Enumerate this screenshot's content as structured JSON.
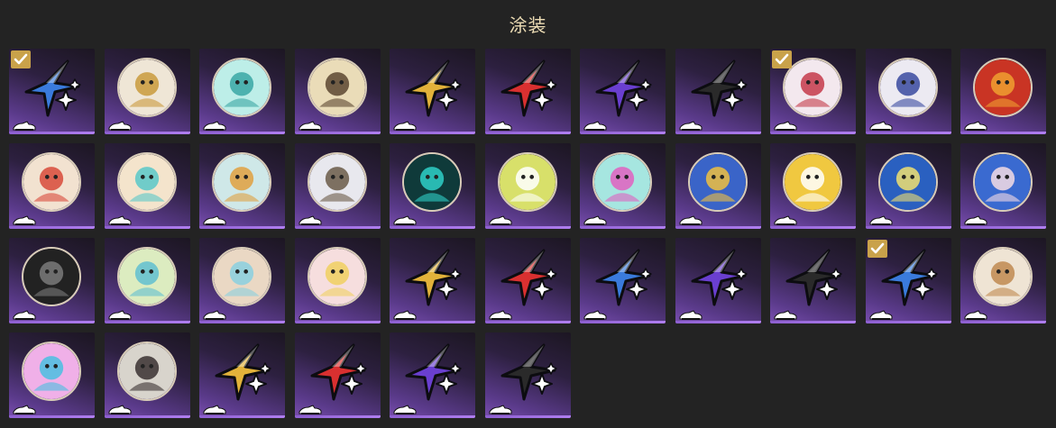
{
  "page_title": "涂装",
  "colors": {
    "background": "#232323",
    "title": "#ecdcb4",
    "check": "#c9a24a",
    "tile_gradient_end": "#7a4fb0"
  },
  "items": [
    {
      "kind": "star",
      "color": "#3a7bdc",
      "equipped": true
    },
    {
      "kind": "badge",
      "icon": "character-badge-icon",
      "bg": "#efe6d6",
      "accent": "#c99a3c",
      "equipped": false
    },
    {
      "kind": "badge",
      "icon": "swirl-badge-icon",
      "bg": "#bdeee8",
      "accent": "#3aa7a4",
      "equipped": false
    },
    {
      "kind": "badge",
      "icon": "character-badge-icon",
      "bg": "#eadcb8",
      "accent": "#5c4630",
      "equipped": false
    },
    {
      "kind": "star",
      "color": "#e2b23a",
      "equipped": false
    },
    {
      "kind": "star",
      "color": "#d93030",
      "equipped": false
    },
    {
      "kind": "star",
      "color": "#6a3fd0",
      "equipped": false
    },
    {
      "kind": "star",
      "color": "#2a2a2a",
      "equipped": false
    },
    {
      "kind": "badge",
      "icon": "shark-badge-icon",
      "bg": "#f3e8ee",
      "accent": "#c43a4a",
      "equipped": true
    },
    {
      "kind": "badge",
      "icon": "helmet-badge-icon",
      "bg": "#eceaf2",
      "accent": "#3a4aa0",
      "equipped": false
    },
    {
      "kind": "badge",
      "icon": "angry-bird-badge-icon",
      "bg": "#c93424",
      "accent": "#f0a030",
      "equipped": false
    },
    {
      "kind": "badge",
      "icon": "group-badge-icon",
      "bg": "#f2e2d0",
      "accent": "#d84a3a",
      "equipped": false
    },
    {
      "kind": "badge",
      "icon": "mecha-badge-icon",
      "bg": "#f4e4cc",
      "accent": "#58c8c8",
      "equipped": false
    },
    {
      "kind": "badge",
      "icon": "character-badge-icon",
      "bg": "#cfe8e8",
      "accent": "#e0a040",
      "equipped": false
    },
    {
      "kind": "badge",
      "icon": "planet-badge-icon",
      "bg": "#e8e8ee",
      "accent": "#6a5a48",
      "equipped": false
    },
    {
      "kind": "badge",
      "icon": "cube-badge-icon",
      "bg": "#0f3a3a",
      "accent": "#2ed0c8",
      "equipped": false
    },
    {
      "kind": "badge",
      "icon": "character-badge-icon",
      "bg": "#d8e06a",
      "accent": "#ffffff",
      "equipped": false
    },
    {
      "kind": "badge",
      "icon": "swirl-badge-icon",
      "bg": "#a6e6e0",
      "accent": "#e060c0",
      "equipped": false
    },
    {
      "kind": "badge",
      "icon": "penguin-badge-icon",
      "bg": "#3a64c8",
      "accent": "#f0c040",
      "equipped": false
    },
    {
      "kind": "badge",
      "icon": "cow-badge-icon",
      "bg": "#f0c840",
      "accent": "#ffffff",
      "equipped": false
    },
    {
      "kind": "badge",
      "icon": "jelly-badge-icon",
      "bg": "#2a60c0",
      "accent": "#f0e070",
      "equipped": false
    },
    {
      "kind": "badge",
      "icon": "character-badge-icon",
      "bg": "#3a6ad0",
      "accent": "#f6dce4",
      "equipped": false
    },
    {
      "kind": "badge",
      "icon": "house-badge-icon",
      "bg": "#222222",
      "accent": "#7a7a7a",
      "equipped": false
    },
    {
      "kind": "badge",
      "icon": "wave-badge-icon",
      "bg": "#dcecc0",
      "accent": "#60c0d0",
      "equipped": false
    },
    {
      "kind": "badge",
      "icon": "bear-badge-icon",
      "bg": "#ead8c4",
      "accent": "#8ad0e0",
      "equipped": false
    },
    {
      "kind": "badge",
      "icon": "bear-badge-icon",
      "bg": "#f6dede",
      "accent": "#f0d060",
      "equipped": false
    },
    {
      "kind": "star",
      "color": "#e2b23a",
      "equipped": false
    },
    {
      "kind": "star",
      "color": "#d93030",
      "equipped": false
    },
    {
      "kind": "star",
      "color": "#3a7bdc",
      "equipped": false
    },
    {
      "kind": "star",
      "color": "#6a3fd0",
      "equipped": false
    },
    {
      "kind": "star",
      "color": "#2a2a2a",
      "equipped": false
    },
    {
      "kind": "star",
      "color": "#3a7bdc",
      "equipped": true
    },
    {
      "kind": "badge",
      "icon": "dog-badge-icon",
      "bg": "#efe4d4",
      "accent": "#c08a50",
      "equipped": false
    },
    {
      "kind": "badge",
      "icon": "cat-badge-icon",
      "bg": "#f0b0e8",
      "accent": "#4ac0e0",
      "equipped": false
    },
    {
      "kind": "badge",
      "icon": "character-badge-icon",
      "bg": "#d8d4cc",
      "accent": "#3a3030",
      "equipped": false
    },
    {
      "kind": "star",
      "color": "#e2b23a",
      "equipped": false
    },
    {
      "kind": "star",
      "color": "#d93030",
      "equipped": false
    },
    {
      "kind": "star",
      "color": "#6a3fd0",
      "equipped": false
    },
    {
      "kind": "star",
      "color": "#2a2a2a",
      "equipped": false
    }
  ]
}
